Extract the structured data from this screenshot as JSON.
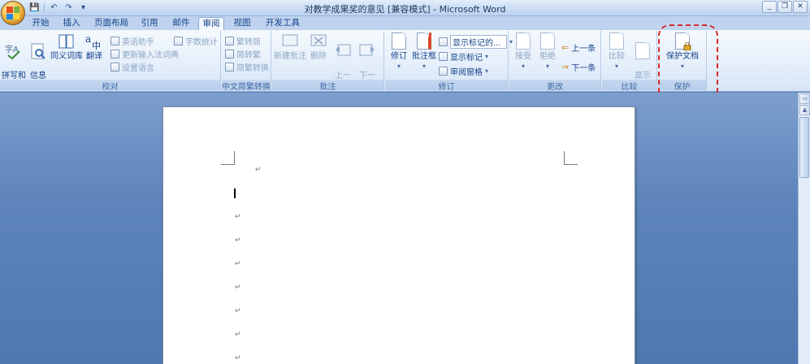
{
  "window": {
    "title": "对教学成果奖的意见 [兼容模式] - Microsoft Word",
    "controls": [
      "_",
      "❐",
      "✕"
    ]
  },
  "qat": [
    "save-icon",
    "undo-icon",
    "redo-icon",
    "customize-icon"
  ],
  "tabs": [
    {
      "label": "开始"
    },
    {
      "label": "插入"
    },
    {
      "label": "页面布局"
    },
    {
      "label": "引用"
    },
    {
      "label": "邮件"
    },
    {
      "label": "审阅",
      "active": true
    },
    {
      "label": "视图"
    },
    {
      "label": "开发工具"
    }
  ],
  "help": "?",
  "groups": {
    "proofing": {
      "label": "校对",
      "spell": "拼写和\n语法",
      "research": "信息\n检索",
      "thesaurus": "同义词库",
      "translate": "翻译",
      "eng_assist": "英语助手",
      "ime_update": "更新输入法词典",
      "set_lang": "设置语言",
      "word_count": "字数统计"
    },
    "chinese": {
      "label": "中文简繁转换",
      "to_simp": "繁转简",
      "to_trad": "简转繁",
      "convert": "简繁转换"
    },
    "comments": {
      "label": "批注",
      "new": "新建批注",
      "delete": "删除",
      "prev": "上一\n条",
      "next": "下一\n条"
    },
    "tracking": {
      "label": "修订",
      "track": "修订",
      "balloons": "批注框",
      "display": "显示标记的...",
      "show_markup": "显示标记",
      "pane": "审阅窗格"
    },
    "changes": {
      "label": "更改",
      "accept": "接受",
      "reject": "拒绝",
      "prev": "上一条",
      "next": "下一条"
    },
    "compare": {
      "label": "比较",
      "compare": "比较",
      "show_source": "显示\n源文档"
    },
    "protect": {
      "label": "保护",
      "protect_doc": "保护文档"
    }
  },
  "document": {
    "paragraph_mark": "↵"
  },
  "colors": {
    "highlight": "#d92b2b",
    "ribbon_text": "#15428b"
  }
}
